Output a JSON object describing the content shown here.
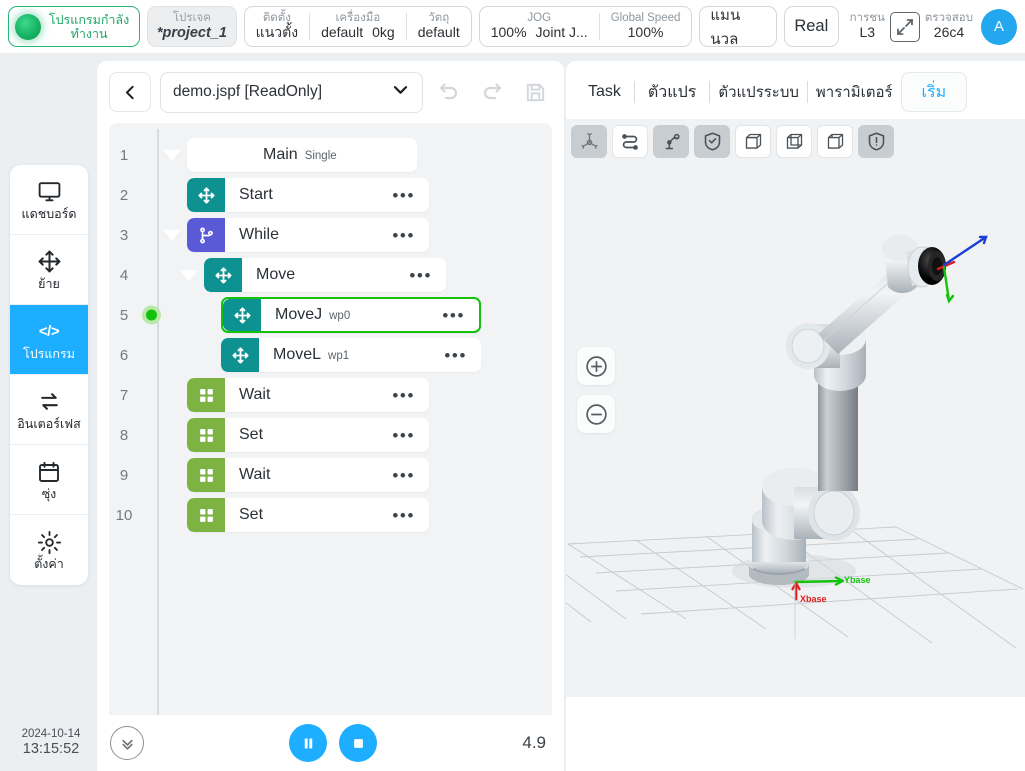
{
  "topbar": {
    "status": {
      "label": "โปรแกรมกำลัง",
      "value": "ทำงาน",
      "color": "#25b877"
    },
    "project": {
      "label": "โปรเจค",
      "value": "*project_1"
    },
    "install": {
      "label": "ติดตั้ง",
      "value": "แนวตั้ง"
    },
    "tool": {
      "label": "เครื่องมือ",
      "value": "default",
      "payload": "0kg"
    },
    "object": {
      "label": "วัตถุ",
      "value": "default"
    },
    "jog": {
      "label": "JOG",
      "value": "100%",
      "mode": "Joint J..."
    },
    "global_speed": {
      "label": "Global Speed",
      "value": "100%"
    },
    "manual_button": "แมนนวล",
    "real_button": "Real",
    "collision": {
      "label": "การชน",
      "value": "L3"
    },
    "check": {
      "label": "ตรวจสอบ",
      "value": "26c4"
    },
    "expand_icon": "expand-arrows-icon",
    "avatar": "A"
  },
  "sidebar": {
    "items": [
      {
        "label": "แดชบอร์ด",
        "icon": "monitor-icon",
        "active": false
      },
      {
        "label": "ย้าย",
        "icon": "move-arrows-icon",
        "active": false
      },
      {
        "label": "โปรแกรม",
        "icon": "code-icon",
        "glyph": "</>",
        "active": true
      },
      {
        "label": "อินเตอร์เฟส",
        "icon": "exchange-arrows-icon",
        "active": false
      },
      {
        "label": "ซุ่ง",
        "icon": "calendar-icon",
        "active": false
      },
      {
        "label": "ตั้งค่า",
        "icon": "gear-icon",
        "active": false
      }
    ],
    "clock": {
      "date": "2024-10-14",
      "time": "13:15:52"
    }
  },
  "program": {
    "toolbar": {
      "back_icon": "chevron-left-icon",
      "file_name": "demo.jspf [ReadOnly]",
      "dropdown_icon": "chevron-down-icon",
      "undo_icon": "undo-icon",
      "redo_icon": "redo-icon",
      "save_icon": "save-icon"
    },
    "tree": [
      {
        "num": "1",
        "label": "Main",
        "sub": "Single",
        "type": "root",
        "tile": null,
        "icon": null,
        "indent": 0,
        "caret": true,
        "dots": false,
        "selected": false,
        "running": false
      },
      {
        "num": "2",
        "label": "Start",
        "sub": "",
        "type": "move",
        "tile": "teal",
        "icon": "move-icon",
        "indent": 1,
        "caret": false,
        "dots": true,
        "selected": false,
        "running": false
      },
      {
        "num": "3",
        "label": "While",
        "sub": "",
        "type": "flow",
        "tile": "purple",
        "icon": "branch-icon",
        "indent": 1,
        "caret": true,
        "dots": true,
        "selected": false,
        "running": false
      },
      {
        "num": "4",
        "label": "Move",
        "sub": "",
        "type": "move",
        "tile": "teal",
        "icon": "move-icon",
        "indent": 2,
        "caret": true,
        "dots": true,
        "selected": false,
        "running": false
      },
      {
        "num": "5",
        "label": "MoveJ",
        "sub": "wp0",
        "type": "move",
        "tile": "teal",
        "icon": "move-icon",
        "indent": 3,
        "caret": false,
        "dots": true,
        "selected": true,
        "running": true
      },
      {
        "num": "6",
        "label": "MoveL",
        "sub": "wp1",
        "type": "move",
        "tile": "teal",
        "icon": "move-icon",
        "indent": 3,
        "caret": false,
        "dots": true,
        "selected": false,
        "running": false
      },
      {
        "num": "7",
        "label": "Wait",
        "sub": "",
        "type": "io",
        "tile": "green",
        "icon": "grid-icon",
        "indent": 1,
        "caret": false,
        "dots": true,
        "selected": false,
        "running": false
      },
      {
        "num": "8",
        "label": "Set",
        "sub": "",
        "type": "io",
        "tile": "green",
        "icon": "grid-icon",
        "indent": 1,
        "caret": false,
        "dots": true,
        "selected": false,
        "running": false
      },
      {
        "num": "9",
        "label": "Wait",
        "sub": "",
        "type": "io",
        "tile": "green",
        "icon": "grid-icon",
        "indent": 1,
        "caret": false,
        "dots": true,
        "selected": false,
        "running": false
      },
      {
        "num": "10",
        "label": "Set",
        "sub": "",
        "type": "io",
        "tile": "green",
        "icon": "grid-icon",
        "indent": 1,
        "caret": false,
        "dots": true,
        "selected": false,
        "running": false
      }
    ],
    "footer": {
      "collapse_icon": "chevron-down-circle-icon",
      "pause_icon": "pause-icon",
      "stop_icon": "stop-icon",
      "value": "4.9"
    }
  },
  "right": {
    "tabs": [
      {
        "label": "Task",
        "active": false
      },
      {
        "label": "ตัวแปร",
        "active": false
      },
      {
        "label": "ตัวแปรระบบ",
        "active": false
      },
      {
        "label": "พารามิเตอร์",
        "active": false
      },
      {
        "label": "เริ่ม",
        "active": true
      }
    ],
    "viewport_tools": [
      {
        "icon": "axes-icon",
        "on": true
      },
      {
        "icon": "path-trace-icon",
        "on": false
      },
      {
        "icon": "robot-arm-icon",
        "on": true
      },
      {
        "icon": "shield-check-icon",
        "on": true
      },
      {
        "icon": "cube-solid-icon",
        "on": false
      },
      {
        "icon": "cube-wire-icon",
        "on": false
      },
      {
        "icon": "cube-half-icon",
        "on": false
      },
      {
        "icon": "shield-warn-icon",
        "on": true
      }
    ],
    "zoom_in_icon": "zoom-in-icon",
    "zoom_out_icon": "zoom-out-icon",
    "scene": {
      "axis_x_label": "Xbase",
      "axis_y_label": "Ybase",
      "axis_x_color": "#e01b1b",
      "axis_y_color": "#13c20a",
      "tcp_axis_colors": [
        "#e01b1b",
        "#13c20a",
        "#1a3fd8"
      ]
    }
  }
}
